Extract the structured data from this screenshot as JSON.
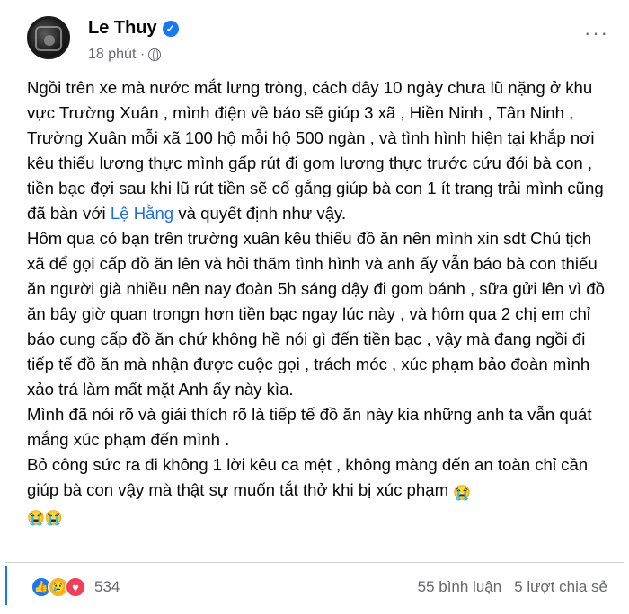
{
  "post": {
    "author": "Le Thuy",
    "time": "18 phút ·",
    "more_icon": "more-options-icon",
    "paragraphs": [
      "Ngồi trên xe mà nước mắt lưng tròng, cách đây 10 ngày chưa lũ nặng ở khu vực Trường Xuân , mình điện về báo sẽ giúp 3 xã , Hiền Ninh , Tân Ninh , Trường Xuân mỗi xã 100 hộ mỗi hộ 500 ngàn , và tình hình hiện tại khắp nơi kêu thiếu lương thực mình gấp rút đi gom lương thực trước cứu đói bà con , tiền bạc đợi sau khi lũ rút tiền sẽ cố gắng giúp bà con 1 ít trang trải mình cũng đã bàn với",
      "Hôm qua có bạn trên trường xuân kêu thiếu đồ ăn nên mình xin sdt Chủ tịch xã để gọi cấp đồ ăn lên và hỏi thăm tình hình và anh ấy vẫn báo bà con thiếu ăn người già nhiều nên nay đoàn 5h sáng dậy đi gom bánh , sữa gửi lên vì đồ ăn bây giờ quan trongn hơn tiền bạc ngay lúc này , và hôm qua 2 chị em chỉ báo cung cấp đồ ăn chứ không hề nói gì đến tiền bạc , vậy mà đang ngồi đi tiếp tế đồ ăn mà nhận được cuộc gọi , trách móc , xúc phạm bảo đoàn mình xảo trá làm mất mặt Anh ấy này kìa.",
      "Mình đã nói rõ và giải thích rõ là tiếp tế đồ ăn này kia những anh ta vẫn quát mắng xúc phạm đến mình .",
      "Bỏ công sức ra đi không 1 lời kêu ca mệt , không màng đến an toàn chỉ cần giúp bà con vậy mà thật sự muốn tắt thở khi bị xúc phạm"
    ],
    "mention": "Lệ Hằng",
    "after_mention": " và quyết định như vậy.",
    "crying_emoji": "😭",
    "reaction_count": "534",
    "comments": "55 bình luận",
    "shares": "5 lượt chia sẻ"
  }
}
